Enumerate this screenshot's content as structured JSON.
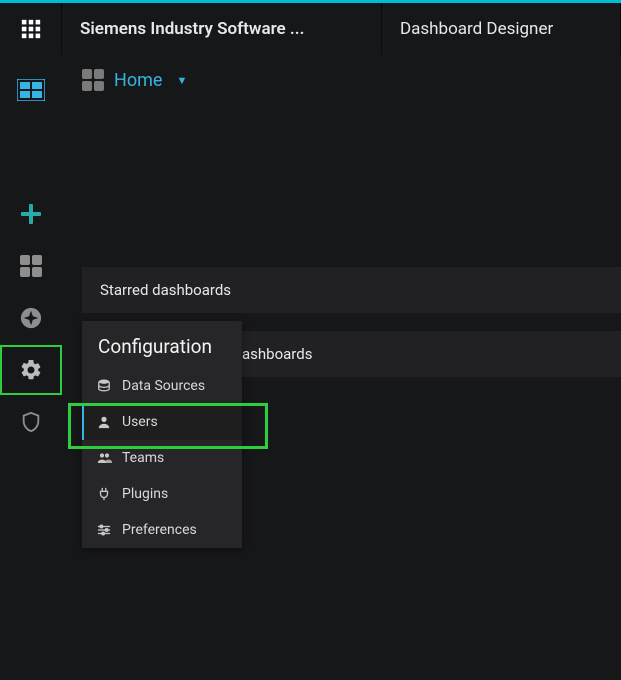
{
  "topbar": {
    "company": "Siemens Industry Software ...",
    "appname": "Dashboard Designer"
  },
  "breadcrumb": {
    "home_label": "Home"
  },
  "panels": {
    "starred": "Starred dashboards",
    "recent": "ashboards"
  },
  "config_menu": {
    "title": "Configuration",
    "items": [
      {
        "label": "Data Sources"
      },
      {
        "label": "Users"
      },
      {
        "label": "Teams"
      },
      {
        "label": "Plugins"
      },
      {
        "label": "Preferences"
      }
    ]
  }
}
